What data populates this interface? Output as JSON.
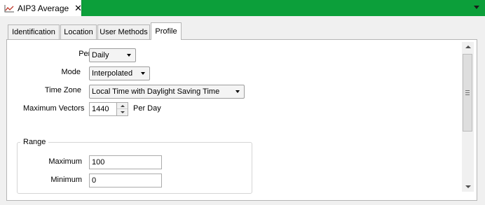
{
  "document_tab": {
    "title": "AIP3 Average",
    "icon": "line-chart-icon",
    "close_glyph": "✕"
  },
  "colors": {
    "strip": "#0c9f3a",
    "panel": "#f0f0f0"
  },
  "tabs": [
    {
      "label": "Identification",
      "active": false
    },
    {
      "label": "Location",
      "active": false
    },
    {
      "label": "User Methods",
      "active": false
    },
    {
      "label": "Profile",
      "active": true
    }
  ],
  "profile": {
    "period": {
      "label": "Period",
      "value": "Daily"
    },
    "mode": {
      "label": "Mode",
      "value": "Interpolated"
    },
    "time_zone": {
      "label": "Time Zone",
      "value": "Local Time with Daylight Saving Time"
    },
    "max_vectors": {
      "label": "Maximum Vectors",
      "value": "1440",
      "suffix": "Per Day"
    },
    "range": {
      "title": "Range",
      "maximum": {
        "label": "Maximum",
        "value": "100"
      },
      "minimum": {
        "label": "Minimum",
        "value": "0"
      }
    }
  }
}
